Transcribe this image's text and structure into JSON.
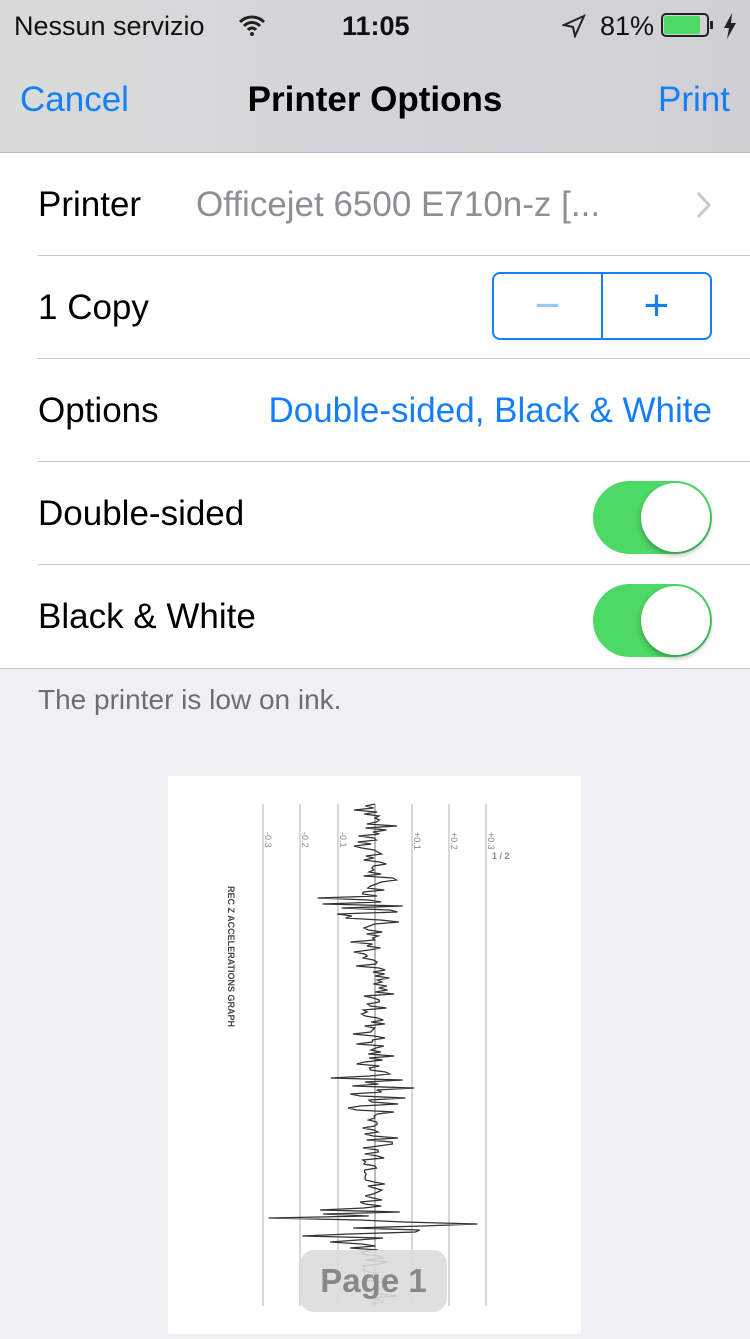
{
  "status_bar": {
    "carrier": "Nessun servizio",
    "time": "11:05",
    "battery": "81%",
    "battery_level": 0.81,
    "icons": [
      "wifi-icon",
      "location-arrow-icon",
      "battery-icon",
      "charging-bolt-icon"
    ]
  },
  "nav": {
    "cancel": "Cancel",
    "title": "Printer Options",
    "print": "Print"
  },
  "rows": {
    "printer_label": "Printer",
    "printer_value": "Officejet 6500 E710n-z [...",
    "copies": "1 Copy",
    "minus": "−",
    "plus": "+",
    "options_label": "Options",
    "options_value": "Double-sided, Black & White",
    "double_sided": "Double-sided",
    "double_sided_on": true,
    "bw": "Black & White",
    "bw_on": true
  },
  "footnote": "The printer is low on ink.",
  "preview": {
    "title": "REC Z ACCELERATIONS GRAPH",
    "axis_labels": [
      "-0.3",
      "-0.2",
      "-0.1",
      "+0.1",
      "+0.2",
      "+0.3"
    ],
    "page_count": "1 / 2",
    "page_label": "Page 1"
  },
  "colors": {
    "accent": "#157efb",
    "toggle_on": "#4cd964"
  }
}
